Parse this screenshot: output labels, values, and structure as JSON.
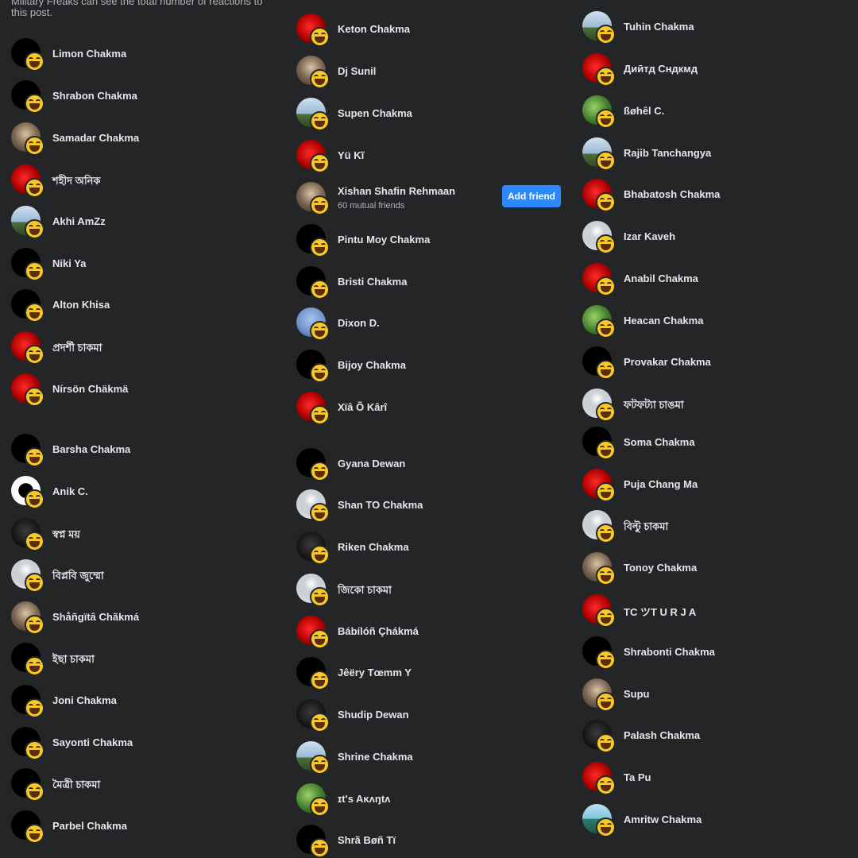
{
  "notice_text": "Military Freaks can see the total number of reactions to this post.",
  "reaction_icon": "haha-emoji",
  "colors": {
    "background": "#242526",
    "text": "#e4e6eb",
    "secondary_text": "#b0b3b8",
    "accent": "#2d88ff",
    "reaction": "#f7c928"
  },
  "columns": [
    {
      "rows": [
        {
          "name": "Limon Chakma"
        },
        {
          "name": "Shrabon Chakma"
        },
        {
          "name": "Samadar Chakma"
        },
        {
          "name": "শহীদ অনিক"
        },
        {
          "name": "Akhi AmZz"
        },
        {
          "name": "Niki Ya"
        },
        {
          "name": "Alton Khisa"
        },
        {
          "name": "প্রদর্শী চাকমা"
        },
        {
          "name": "Nírsön Chäkmä"
        },
        {
          "name": "Barsha Chakma"
        },
        {
          "name": "Anik C."
        },
        {
          "name": "স্বপ্ন ময়"
        },
        {
          "name": "বিপ্লবি জুম্মো"
        },
        {
          "name": "Shåñgïtâ Chãkmá"
        },
        {
          "name": "ইছা চাকমা"
        },
        {
          "name": "Joni Chakma"
        },
        {
          "name": "Sayonti Chakma"
        },
        {
          "name": "মৈত্রী চাকমা"
        },
        {
          "name": "Parbel Chakma"
        }
      ]
    },
    {
      "rows": [
        {
          "name": "Keton Chakma"
        },
        {
          "name": "Dj Sunil"
        },
        {
          "name": "Supen Chakma"
        },
        {
          "name": "Yü Kĩ"
        },
        {
          "name": "Xishan Shafin Rehmaan",
          "mutual": "60 mutual friends",
          "action": "Add friend"
        },
        {
          "name": "Pintu Moy Chakma"
        },
        {
          "name": "Bristi Chakma"
        },
        {
          "name": "Dixon D."
        },
        {
          "name": "Bijoy Chakma"
        },
        {
          "name": "Xïâ Õ Kârî"
        },
        {
          "name": "Gyana Dewan"
        },
        {
          "name": "Shan TO Chakma"
        },
        {
          "name": "Riken Chakma"
        },
        {
          "name": "জিকো চাকমা"
        },
        {
          "name": "Bábílóñ Çhákmá"
        },
        {
          "name": "Jêëry Tœmm Y"
        },
        {
          "name": "Shudip Dewan"
        },
        {
          "name": "Shrine Chakma"
        },
        {
          "name": "ɪt's Aĸʌŋtʌ"
        },
        {
          "name": "Shrã Bøñ Tï"
        }
      ]
    },
    {
      "rows": [
        {
          "name": "Tuhin Chakma"
        },
        {
          "name": "Диӣтд Сндкмд"
        },
        {
          "name": "ßøhêl C."
        },
        {
          "name": "Rajib Tanchangya"
        },
        {
          "name": "Bhabatosh Chakma"
        },
        {
          "name": "Izar Kaveh"
        },
        {
          "name": "Anabil Chakma"
        },
        {
          "name": "Heacan Chakma"
        },
        {
          "name": "Provakar Chakma"
        },
        {
          "name": "ফটফট্যা চাঙমা"
        },
        {
          "name": "Soma Chakma"
        },
        {
          "name": "Puja Chang Ma"
        },
        {
          "name": "বিল্টু চাকমা"
        },
        {
          "name": "Tonoy Chakma"
        },
        {
          "name": "TC ツT U R J A"
        },
        {
          "name": "Shrabonti Chakma"
        },
        {
          "name": "Supu"
        },
        {
          "name": "Palash Chakma"
        },
        {
          "name": "Ta Pu"
        },
        {
          "name": "Amritw Chakma"
        }
      ]
    }
  ]
}
